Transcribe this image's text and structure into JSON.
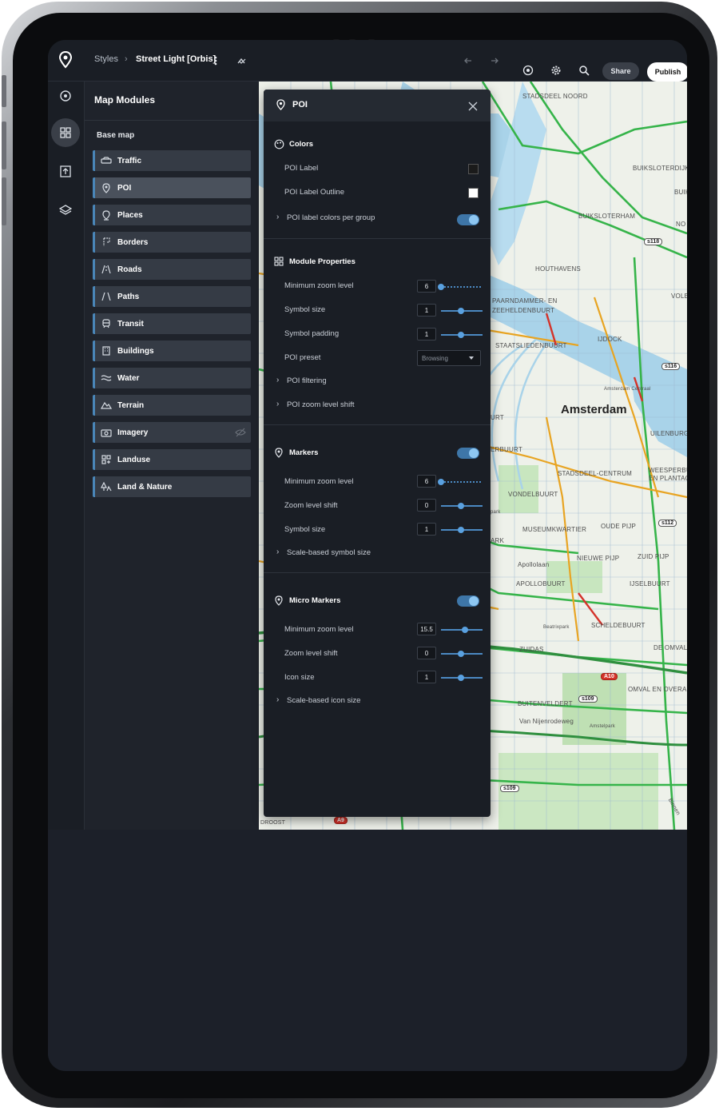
{
  "topbar": {
    "breadcrumb_root": "Styles",
    "style_name": "Street Light [Orbis]",
    "share_label": "Share",
    "publish_label": "Publish"
  },
  "modules": {
    "title": "Map Modules",
    "section_label": "Base map",
    "items": [
      {
        "label": "Traffic",
        "icon": "car-icon"
      },
      {
        "label": "POI",
        "icon": "pin-icon",
        "active": true
      },
      {
        "label": "Places",
        "icon": "place-pin-icon"
      },
      {
        "label": "Borders",
        "icon": "borders-icon"
      },
      {
        "label": "Roads",
        "icon": "road-icon"
      },
      {
        "label": "Paths",
        "icon": "path-icon"
      },
      {
        "label": "Transit",
        "icon": "train-icon"
      },
      {
        "label": "Buildings",
        "icon": "building-icon"
      },
      {
        "label": "Water",
        "icon": "water-icon"
      },
      {
        "label": "Terrain",
        "icon": "mountain-icon"
      },
      {
        "label": "Imagery",
        "icon": "camera-icon",
        "hidden": true
      },
      {
        "label": "Landuse",
        "icon": "landuse-icon"
      },
      {
        "label": "Land & Nature",
        "icon": "tree-icon"
      }
    ]
  },
  "poi": {
    "title": "POI",
    "colors": {
      "title": "Colors",
      "poi_label": "POI Label",
      "poi_label_color": "#1b1b1b",
      "poi_label_outline": "POI Label Outline",
      "poi_label_outline_color": "#ffffff",
      "colors_per_group": "POI label colors per group"
    },
    "module_properties": {
      "title": "Module Properties",
      "min_zoom_label": "Minimum zoom level",
      "min_zoom_value": "6",
      "symbol_size_label": "Symbol size",
      "symbol_size_value": "1",
      "symbol_padding_label": "Symbol padding",
      "symbol_padding_value": "1",
      "preset_label": "POI preset",
      "preset_value": "Browsing",
      "filtering_label": "POI filtering",
      "zoom_shift_label": "POI zoom level shift"
    },
    "markers": {
      "title": "Markers",
      "min_zoom_label": "Minimum zoom level",
      "min_zoom_value": "6",
      "zoom_shift_label": "Zoom level shift",
      "zoom_shift_value": "0",
      "symbol_size_label": "Symbol size",
      "symbol_size_value": "1",
      "scale_label": "Scale-based symbol size"
    },
    "micro_markers": {
      "title": "Micro Markers",
      "min_zoom_label": "Minimum zoom level",
      "min_zoom_value": "15.5",
      "zoom_shift_label": "Zoom level shift",
      "zoom_shift_value": "0",
      "icon_size_label": "Icon size",
      "icon_size_value": "1",
      "scale_label": "Scale-based icon size"
    }
  },
  "map": {
    "city": "Amsterdam",
    "labels": {
      "noord": "STADSDEEL NOORD",
      "buiksloter": "BUIKSLOTERDIJK",
      "buik": "BUIK",
      "buiksloterham": "BUIKSLOTERHAM",
      "no": "NO",
      "houthavens": "HOUTHAVENS",
      "volew": "VOLEW",
      "spaarndammer1": "PAARNDAMMER- EN",
      "spaarndammer2": "ZEEHELDENBUURT",
      "ijdock": "IJDOCK",
      "staatslieden": "STAATSLIEDENBUURT",
      "centraal": "Amsterdam Centraal",
      "urt": "URT",
      "uilenburg": "UILENBURG",
      "erbuurt": "ERBUURT",
      "centrum": "STADSDEEL-CENTRUM",
      "weesper1": "WEESPERBU",
      "weesper2": "EN PLANTAG",
      "vondel": "VONDELBUURT",
      "park": "park",
      "museum": "MUSEUMKWARTIER",
      "oudepijp": "OUDE PIJP",
      "ark": "ARK",
      "apollolaan": "Apollolaan",
      "nieuwepijp": "NIEUWE PIJP",
      "zuidpijp": "ZUID PIJP",
      "apollobuurt": "APOLLOBUURT",
      "ijsselbuurt": "IJSELBUURT",
      "beatrix": "Beatrixpark",
      "schelde": "SCHELDEBUURT",
      "zuidas": "ZUIDAS",
      "deomval": "DE OMVAL",
      "omvaloveram": "OMVAL EN OVERAM",
      "buitenveldert": "BUITENVELDERT",
      "nijenrode": "Van Nijenrodeweg",
      "amstelpark": "Amstelpark",
      "noost": "DROOST",
      "binnen": "Binnen"
    },
    "shields": {
      "s118": "s118",
      "s116": "s116",
      "s112": "s112",
      "a10": "A10",
      "s109a": "s109",
      "s109b": "s109",
      "a9": "A9"
    }
  }
}
